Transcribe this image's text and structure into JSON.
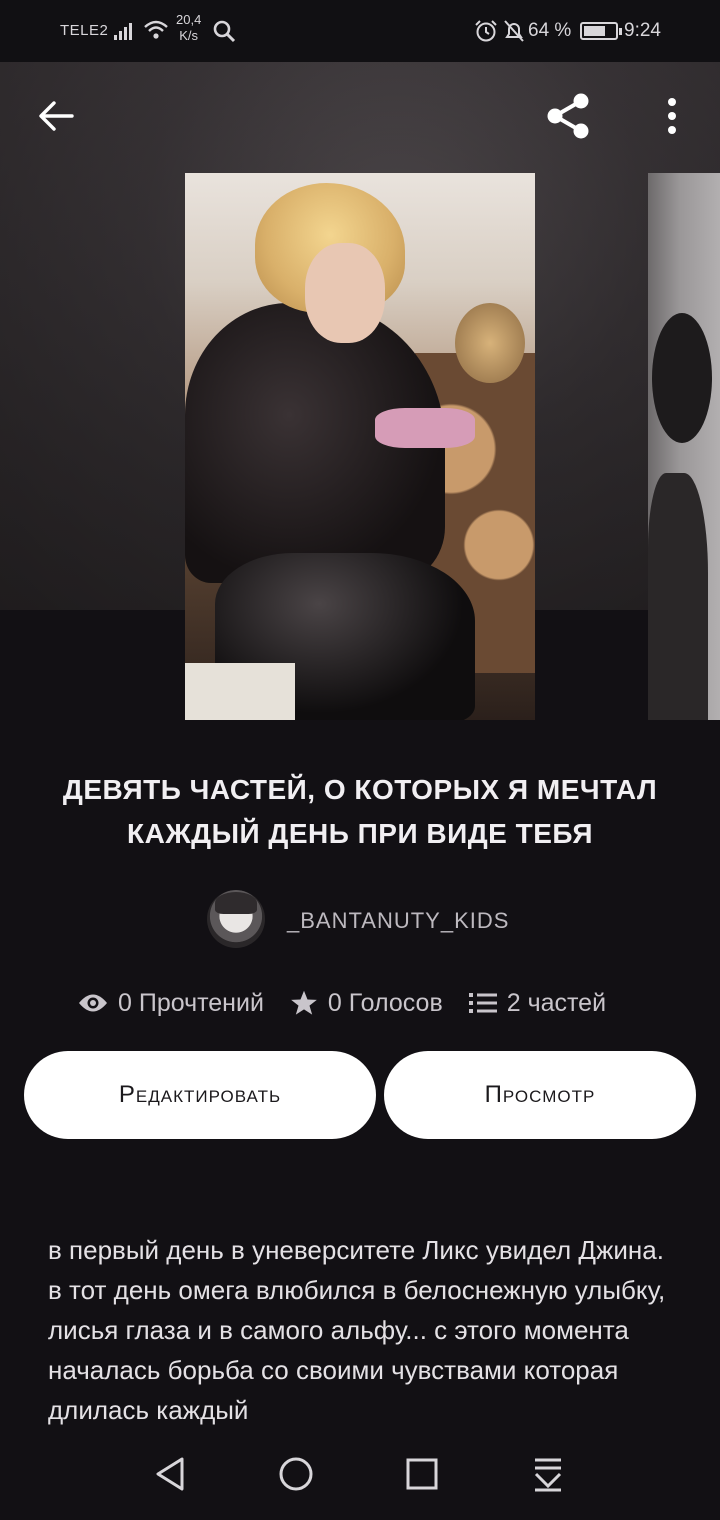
{
  "status_bar": {
    "carrier": "Tele2",
    "speed_value": "20,4",
    "speed_unit": "K/s",
    "battery_percent": "64 %",
    "time": "9:24"
  },
  "header": {
    "icons": [
      "back-arrow-icon",
      "share-icon",
      "more-vertical-icon"
    ]
  },
  "story": {
    "title": "ДЕВЯТЬ ЧАСТЕЙ, О КОТОРЫХ Я МЕЧТАЛ КАЖДЫЙ ДЕНЬ ПРИ ВИДЕ ТЕБЯ",
    "author": "_BANTANUTY_KIDS",
    "stats": {
      "reads": "0 Прочтений",
      "votes": "0 Голосов",
      "parts": "2 частей"
    },
    "description": "в первый день в уневерситете Ликс увидел Джина. в тот день омега влюбился в белоснежную улыбку, лисья глаза и в самого альфу... с этого момента началась борьба со своими чувствами которая длилась каждый"
  },
  "buttons": {
    "edit": "Редактировать",
    "preview": "Просмотр"
  },
  "colors": {
    "background": "#121014",
    "text": "#e9e6ea",
    "button_bg": "#ffffff"
  }
}
